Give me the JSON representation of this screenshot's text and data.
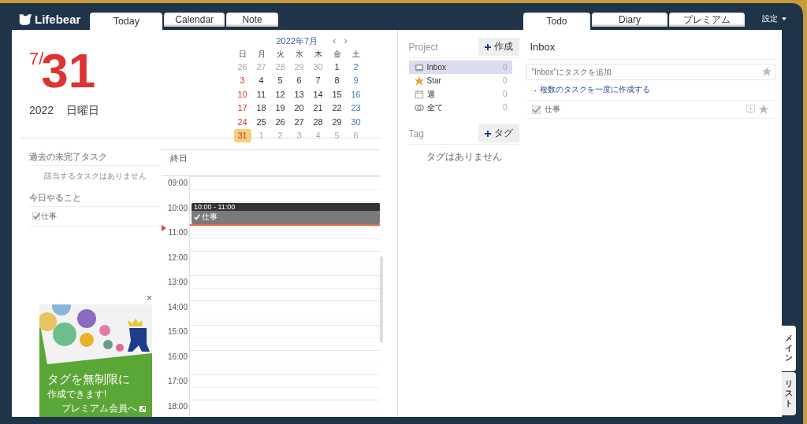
{
  "app": {
    "logo": "Lifebear"
  },
  "left_tabs": [
    {
      "label": "Today",
      "selected": true
    },
    {
      "label": "Calendar",
      "selected": false
    },
    {
      "label": "Note",
      "selected": false
    }
  ],
  "right_tabs": [
    {
      "label": "Todo",
      "selected": true
    },
    {
      "label": "Diary",
      "selected": false
    },
    {
      "label": "プレミアム",
      "selected": false
    }
  ],
  "settings_menu": "設定",
  "today": {
    "month": "7/",
    "day": "31",
    "year": "2022",
    "weekday": "日曜日"
  },
  "mini_calendar": {
    "title": "2022年7月",
    "prev": "‹",
    "next": "›",
    "weekdays": [
      "日",
      "月",
      "火",
      "水",
      "木",
      "金",
      "土"
    ],
    "weeks": [
      [
        {
          "day": "26",
          "kind": "other",
          "selected": false
        },
        {
          "day": "27",
          "kind": "other",
          "selected": false
        },
        {
          "day": "28",
          "kind": "other",
          "selected": false
        },
        {
          "day": "29",
          "kind": "other",
          "selected": false
        },
        {
          "day": "30",
          "kind": "other",
          "selected": false
        },
        {
          "day": "1",
          "kind": "day",
          "selected": false
        },
        {
          "day": "2",
          "kind": "sat",
          "selected": false
        }
      ],
      [
        {
          "day": "3",
          "kind": "sun",
          "selected": false
        },
        {
          "day": "4",
          "kind": "day",
          "selected": false
        },
        {
          "day": "5",
          "kind": "day",
          "selected": false
        },
        {
          "day": "6",
          "kind": "day",
          "selected": false
        },
        {
          "day": "7",
          "kind": "day",
          "selected": false
        },
        {
          "day": "8",
          "kind": "day",
          "selected": false
        },
        {
          "day": "9",
          "kind": "sat",
          "selected": false
        }
      ],
      [
        {
          "day": "10",
          "kind": "sun",
          "selected": false
        },
        {
          "day": "11",
          "kind": "day",
          "selected": false
        },
        {
          "day": "12",
          "kind": "day",
          "selected": false
        },
        {
          "day": "13",
          "kind": "day",
          "selected": false
        },
        {
          "day": "14",
          "kind": "day",
          "selected": false
        },
        {
          "day": "15",
          "kind": "day",
          "selected": false
        },
        {
          "day": "16",
          "kind": "sat",
          "selected": false
        }
      ],
      [
        {
          "day": "17",
          "kind": "sun",
          "selected": false
        },
        {
          "day": "18",
          "kind": "day",
          "selected": false
        },
        {
          "day": "19",
          "kind": "day",
          "selected": false
        },
        {
          "day": "20",
          "kind": "day",
          "selected": false
        },
        {
          "day": "21",
          "kind": "day",
          "selected": false
        },
        {
          "day": "22",
          "kind": "day",
          "selected": false
        },
        {
          "day": "23",
          "kind": "sat",
          "selected": false
        }
      ],
      [
        {
          "day": "24",
          "kind": "sun",
          "selected": false
        },
        {
          "day": "25",
          "kind": "day",
          "selected": false
        },
        {
          "day": "26",
          "kind": "day",
          "selected": false
        },
        {
          "day": "27",
          "kind": "day",
          "selected": false
        },
        {
          "day": "28",
          "kind": "day",
          "selected": false
        },
        {
          "day": "29",
          "kind": "day",
          "selected": false
        },
        {
          "day": "30",
          "kind": "sat",
          "selected": false
        }
      ],
      [
        {
          "day": "31",
          "kind": "sun",
          "selected": true
        },
        {
          "day": "1",
          "kind": "other",
          "selected": false
        },
        {
          "day": "2",
          "kind": "other",
          "selected": false
        },
        {
          "day": "3",
          "kind": "other",
          "selected": false
        },
        {
          "day": "4",
          "kind": "other",
          "selected": false
        },
        {
          "day": "5",
          "kind": "other",
          "selected": false
        },
        {
          "day": "6",
          "kind": "other",
          "selected": false
        }
      ]
    ]
  },
  "past_tasks": {
    "title": "過去の未完了タスク",
    "empty": "該当するタスクはありません"
  },
  "today_tasks": {
    "title": "今日やること",
    "items": [
      {
        "label": "仕事",
        "checked": true
      }
    ]
  },
  "ad": {
    "close": "×",
    "headline": "タグを無制限に",
    "subline": "作成できます!",
    "link": "プレミアム会員へ"
  },
  "timeline": {
    "all_day": "終日",
    "hours": [
      {
        "label": "09:00"
      },
      {
        "label": "10:00",
        "events": [
          {
            "time": "10:00 - 11:00",
            "title": "仕事",
            "checked": true
          }
        ]
      },
      {
        "label": "11:00"
      },
      {
        "label": "12:00"
      },
      {
        "label": "13:00"
      },
      {
        "label": "14:00"
      },
      {
        "label": "15:00"
      },
      {
        "label": "16:00"
      },
      {
        "label": "17:00"
      },
      {
        "label": "18:00"
      }
    ]
  },
  "projects": {
    "title": "Project",
    "add": "作成",
    "items": [
      {
        "label": "Inbox",
        "count": "0",
        "kind": "inbox",
        "selected": true
      },
      {
        "label": "Star",
        "count": "0",
        "kind": "star",
        "selected": false
      },
      {
        "label": "週",
        "count": "0",
        "kind": "week",
        "selected": false
      },
      {
        "label": "全て",
        "count": "0",
        "kind": "all",
        "selected": false
      }
    ]
  },
  "tags": {
    "title": "Tag",
    "add": "タグ",
    "empty": "タグはありません"
  },
  "inbox": {
    "title": "Inbox",
    "placeholder": "\"Inbox\"にタスクを追加",
    "bulk_link": "→ 複数のタスクを一度に作成する",
    "tasks": [
      {
        "label": "仕事",
        "checked": true
      }
    ]
  },
  "side_tabs": [
    {
      "label": "メイン",
      "selected": true
    },
    {
      "label": "リスト",
      "selected": false
    }
  ]
}
